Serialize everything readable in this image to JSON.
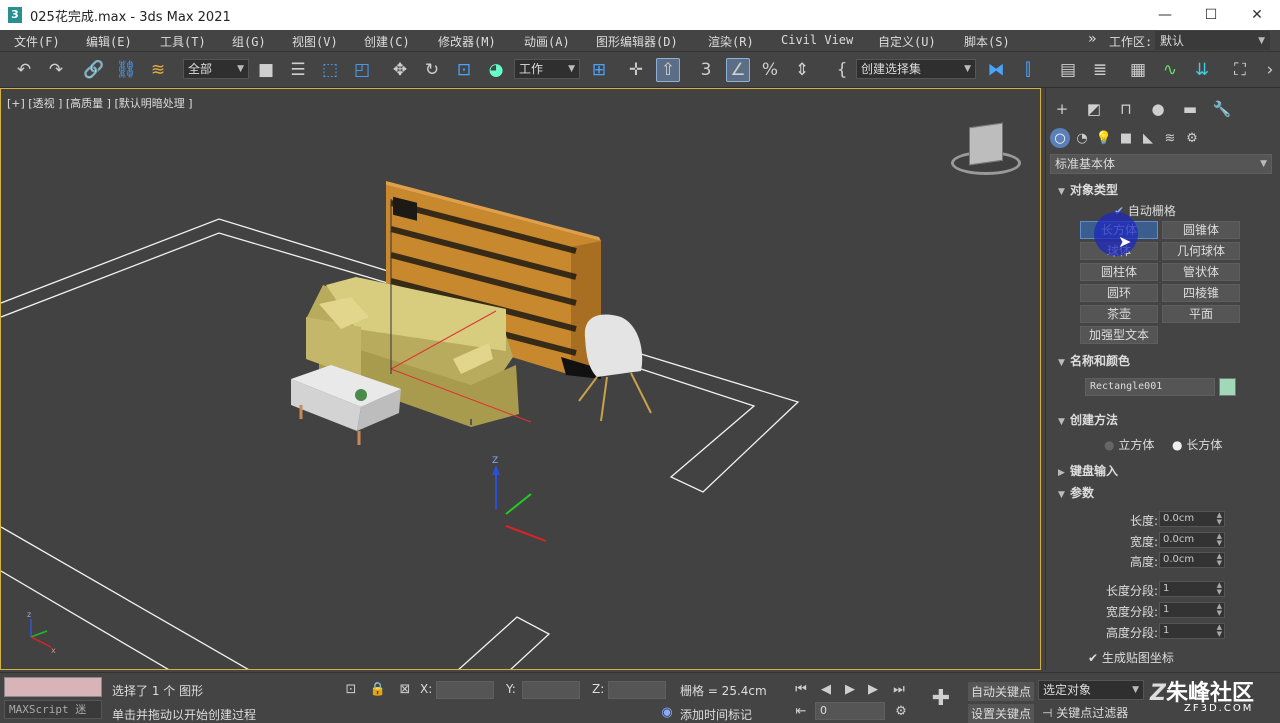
{
  "window": {
    "app_icon": "3",
    "title": "025花完成.max - 3ds Max 2021",
    "minimize": "—",
    "maximize": "☐",
    "close": "✕"
  },
  "menu": {
    "items": [
      "文件(F)",
      "编辑(E)",
      "工具(T)",
      "组(G)",
      "视图(V)",
      "创建(C)",
      "修改器(M)",
      "动画(A)",
      "图形编辑器(D)",
      "渲染(R)",
      "Civil View",
      "自定义(U)",
      "脚本(S)"
    ],
    "more": "»",
    "workspace_label": "工作区:",
    "workspace_value": "默认"
  },
  "toolbar": {
    "selection_filter": "全部",
    "coord_system": "工作",
    "named_selection_placeholder": "创建选择集"
  },
  "viewport": {
    "label": "[+] [透视 ] [高质量 ] [默认明暗处理 ]",
    "gizmo_z": "Z",
    "axis_z": "z",
    "axis_x": "x"
  },
  "command_panel": {
    "category": "标准基本体",
    "object_type": {
      "header": "对象类型",
      "autogrid": "自动栅格",
      "buttons": [
        "长方体",
        "圆锥体",
        "球体",
        "几何球体",
        "圆柱体",
        "管状体",
        "圆环",
        "四棱锥",
        "茶壶",
        "平面",
        "加强型文本"
      ]
    },
    "name_color": {
      "header": "名称和颜色",
      "name": "Rectangle001",
      "color": "#9fd9b8"
    },
    "creation_method": {
      "header": "创建方法",
      "options": [
        "立方体",
        "长方体"
      ],
      "selected": "长方体"
    },
    "keyboard_entry": {
      "header": "键盘输入"
    },
    "parameters": {
      "header": "参数",
      "length_label": "长度:",
      "length": "0.0cm",
      "width_label": "宽度:",
      "width": "0.0cm",
      "height_label": "高度:",
      "height": "0.0cm",
      "length_segs_label": "长度分段:",
      "length_segs": "1",
      "width_segs_label": "宽度分段:",
      "width_segs": "1",
      "height_segs_label": "高度分段:",
      "height_segs": "1",
      "gen_map_coords": "生成贴图坐标"
    }
  },
  "status": {
    "maxscript": "MAXScript 迷",
    "selected": "选择了 1 个 图形",
    "prompt": "单击并拖动以开始创建过程",
    "x_label": "X:",
    "y_label": "Y:",
    "z_label": "Z:",
    "grid": "栅格 = 25.4cm",
    "add_time_tag": "添加时间标记",
    "auto_key": "自动关键点",
    "set_key": "设置关键点",
    "key_target": "选定对象",
    "key_filters": "关键点过滤器",
    "frame": "0"
  },
  "watermark": {
    "brand": "朱峰社区",
    "url": "ZF3D.COM"
  },
  "colors": {
    "accent": "#3b5e8f",
    "viewport_border": "#d8b040",
    "timeline_pink": "#d8b4b8"
  }
}
